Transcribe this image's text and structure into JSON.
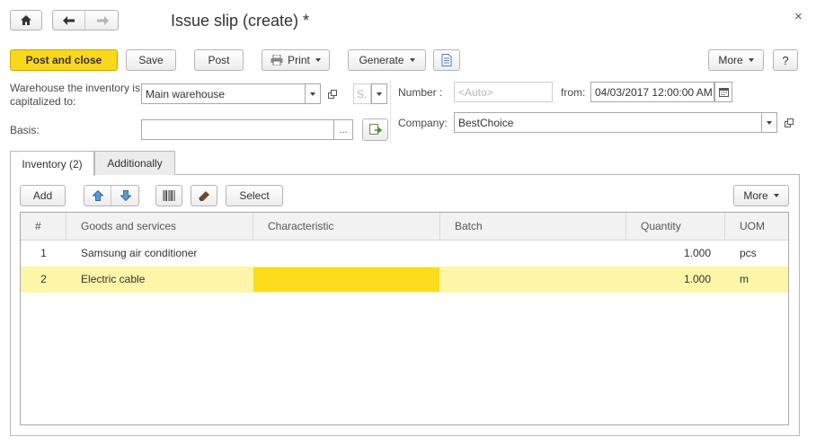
{
  "window": {
    "title": "Issue slip (create) *",
    "close_glyph": "×"
  },
  "nav": {
    "home": "home-icon",
    "back": "arrow-left-icon",
    "forward": "arrow-right-icon"
  },
  "toolbar": {
    "post_and_close": "Post and close",
    "save": "Save",
    "post": "Post",
    "print": "Print",
    "generate": "Generate",
    "more": "More",
    "help": "?"
  },
  "form": {
    "warehouse_label": "Warehouse the inventory is capitalized to:",
    "warehouse_value": "Main warehouse",
    "warehouse_s_value": "S.",
    "number_label": "Number :",
    "number_placeholder": "<Auto>",
    "from_label": "from:",
    "date_value": "04/03/2017 12:00:00 AM",
    "basis_label": "Basis:",
    "basis_value": "",
    "basis_btn": "...",
    "company_label": "Company:",
    "company_value": "BestChoice"
  },
  "tabs": [
    {
      "label": "Inventory (2)",
      "active": true
    },
    {
      "label": "Additionally",
      "active": false
    }
  ],
  "table_toolbar": {
    "add": "Add",
    "select": "Select",
    "more": "More"
  },
  "table": {
    "columns": [
      "#",
      "Goods and services",
      "Characteristic",
      "Batch",
      "Quantity",
      "UOM"
    ],
    "rows": [
      {
        "n": "1",
        "goods": "Samsung air conditioner",
        "characteristic": "",
        "batch": "",
        "quantity": "1.000",
        "uom": "pcs"
      },
      {
        "n": "2",
        "goods": "Electric cable",
        "characteristic": "",
        "batch": "",
        "quantity": "1.000",
        "uom": "m"
      }
    ]
  },
  "colors": {
    "accent": "#f9d71b",
    "selected_row": "#fdf5a8",
    "selected_cell": "#fcdc1c"
  }
}
